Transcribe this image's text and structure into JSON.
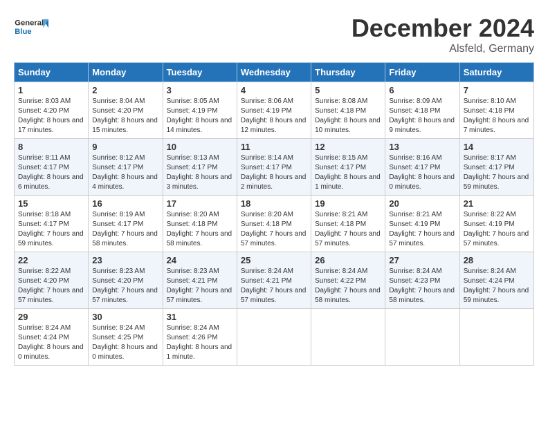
{
  "header": {
    "logo_line1": "General",
    "logo_line2": "Blue",
    "month": "December 2024",
    "location": "Alsfeld, Germany"
  },
  "weekdays": [
    "Sunday",
    "Monday",
    "Tuesday",
    "Wednesday",
    "Thursday",
    "Friday",
    "Saturday"
  ],
  "weeks": [
    [
      {
        "day": "1",
        "sunrise": "8:03 AM",
        "sunset": "4:20 PM",
        "daylight": "8 hours and 17 minutes."
      },
      {
        "day": "2",
        "sunrise": "8:04 AM",
        "sunset": "4:20 PM",
        "daylight": "8 hours and 15 minutes."
      },
      {
        "day": "3",
        "sunrise": "8:05 AM",
        "sunset": "4:19 PM",
        "daylight": "8 hours and 14 minutes."
      },
      {
        "day": "4",
        "sunrise": "8:06 AM",
        "sunset": "4:19 PM",
        "daylight": "8 hours and 12 minutes."
      },
      {
        "day": "5",
        "sunrise": "8:08 AM",
        "sunset": "4:18 PM",
        "daylight": "8 hours and 10 minutes."
      },
      {
        "day": "6",
        "sunrise": "8:09 AM",
        "sunset": "4:18 PM",
        "daylight": "8 hours and 9 minutes."
      },
      {
        "day": "7",
        "sunrise": "8:10 AM",
        "sunset": "4:18 PM",
        "daylight": "8 hours and 7 minutes."
      }
    ],
    [
      {
        "day": "8",
        "sunrise": "8:11 AM",
        "sunset": "4:17 PM",
        "daylight": "8 hours and 6 minutes."
      },
      {
        "day": "9",
        "sunrise": "8:12 AM",
        "sunset": "4:17 PM",
        "daylight": "8 hours and 4 minutes."
      },
      {
        "day": "10",
        "sunrise": "8:13 AM",
        "sunset": "4:17 PM",
        "daylight": "8 hours and 3 minutes."
      },
      {
        "day": "11",
        "sunrise": "8:14 AM",
        "sunset": "4:17 PM",
        "daylight": "8 hours and 2 minutes."
      },
      {
        "day": "12",
        "sunrise": "8:15 AM",
        "sunset": "4:17 PM",
        "daylight": "8 hours and 1 minute."
      },
      {
        "day": "13",
        "sunrise": "8:16 AM",
        "sunset": "4:17 PM",
        "daylight": "8 hours and 0 minutes."
      },
      {
        "day": "14",
        "sunrise": "8:17 AM",
        "sunset": "4:17 PM",
        "daylight": "7 hours and 59 minutes."
      }
    ],
    [
      {
        "day": "15",
        "sunrise": "8:18 AM",
        "sunset": "4:17 PM",
        "daylight": "7 hours and 59 minutes."
      },
      {
        "day": "16",
        "sunrise": "8:19 AM",
        "sunset": "4:17 PM",
        "daylight": "7 hours and 58 minutes."
      },
      {
        "day": "17",
        "sunrise": "8:20 AM",
        "sunset": "4:18 PM",
        "daylight": "7 hours and 58 minutes."
      },
      {
        "day": "18",
        "sunrise": "8:20 AM",
        "sunset": "4:18 PM",
        "daylight": "7 hours and 57 minutes."
      },
      {
        "day": "19",
        "sunrise": "8:21 AM",
        "sunset": "4:18 PM",
        "daylight": "7 hours and 57 minutes."
      },
      {
        "day": "20",
        "sunrise": "8:21 AM",
        "sunset": "4:19 PM",
        "daylight": "7 hours and 57 minutes."
      },
      {
        "day": "21",
        "sunrise": "8:22 AM",
        "sunset": "4:19 PM",
        "daylight": "7 hours and 57 minutes."
      }
    ],
    [
      {
        "day": "22",
        "sunrise": "8:22 AM",
        "sunset": "4:20 PM",
        "daylight": "7 hours and 57 minutes."
      },
      {
        "day": "23",
        "sunrise": "8:23 AM",
        "sunset": "4:20 PM",
        "daylight": "7 hours and 57 minutes."
      },
      {
        "day": "24",
        "sunrise": "8:23 AM",
        "sunset": "4:21 PM",
        "daylight": "7 hours and 57 minutes."
      },
      {
        "day": "25",
        "sunrise": "8:24 AM",
        "sunset": "4:21 PM",
        "daylight": "7 hours and 57 minutes."
      },
      {
        "day": "26",
        "sunrise": "8:24 AM",
        "sunset": "4:22 PM",
        "daylight": "7 hours and 58 minutes."
      },
      {
        "day": "27",
        "sunrise": "8:24 AM",
        "sunset": "4:23 PM",
        "daylight": "7 hours and 58 minutes."
      },
      {
        "day": "28",
        "sunrise": "8:24 AM",
        "sunset": "4:24 PM",
        "daylight": "7 hours and 59 minutes."
      }
    ],
    [
      {
        "day": "29",
        "sunrise": "8:24 AM",
        "sunset": "4:24 PM",
        "daylight": "8 hours and 0 minutes."
      },
      {
        "day": "30",
        "sunrise": "8:24 AM",
        "sunset": "4:25 PM",
        "daylight": "8 hours and 0 minutes."
      },
      {
        "day": "31",
        "sunrise": "8:24 AM",
        "sunset": "4:26 PM",
        "daylight": "8 hours and 1 minute."
      },
      null,
      null,
      null,
      null
    ]
  ],
  "labels": {
    "sunrise": "Sunrise:",
    "sunset": "Sunset:",
    "daylight": "Daylight:"
  }
}
